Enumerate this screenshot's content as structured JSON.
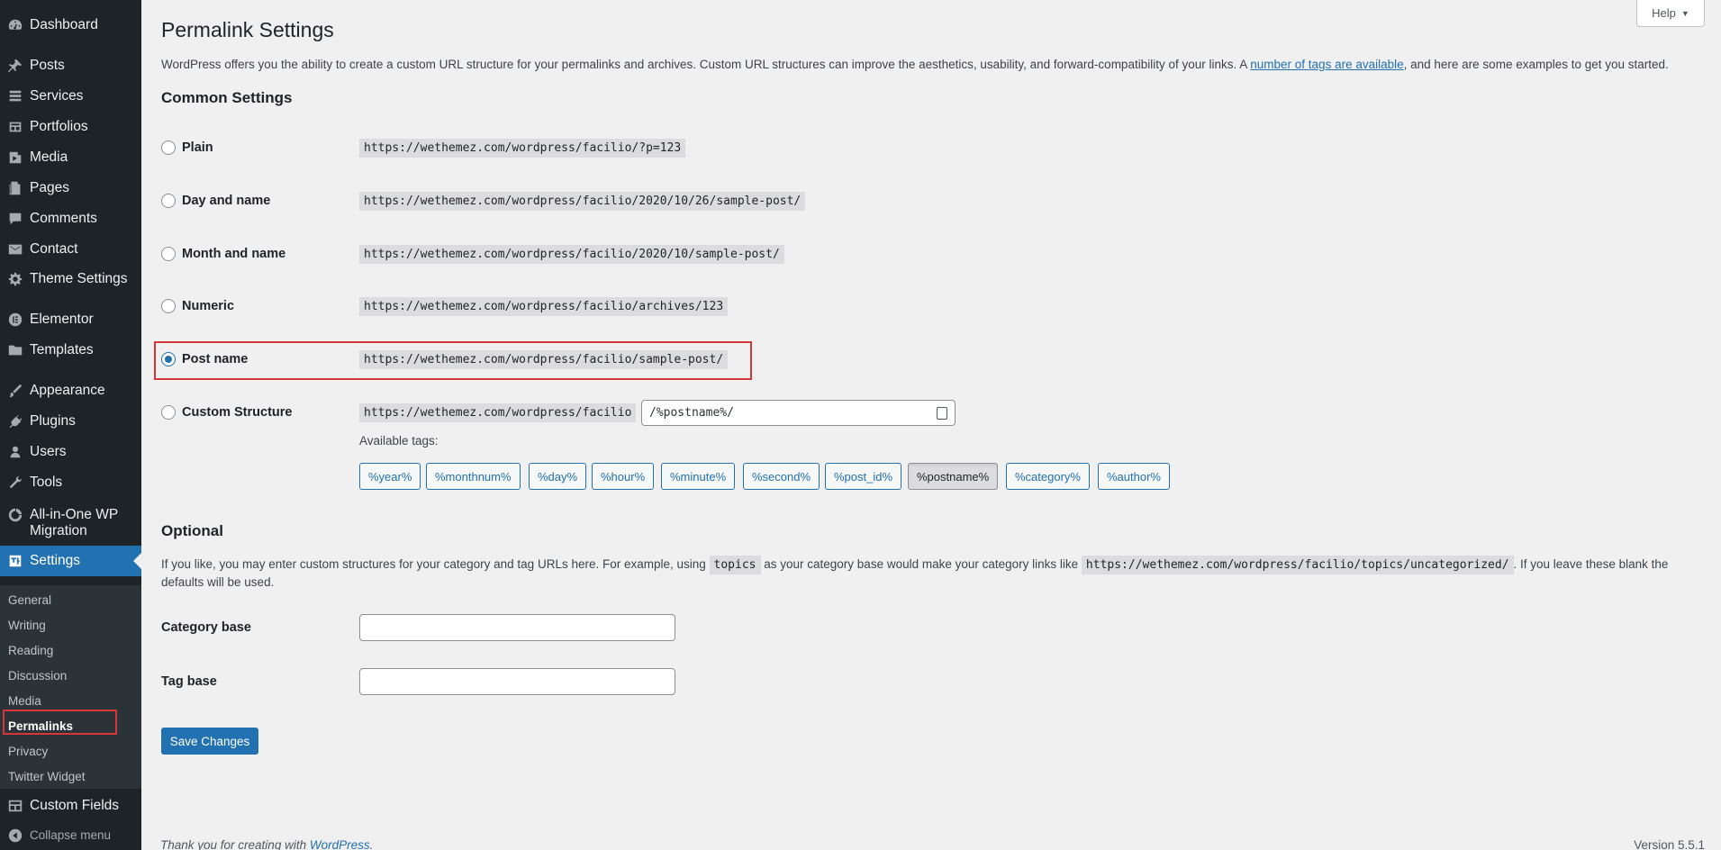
{
  "sidebar": {
    "items": [
      {
        "label": "Dashboard",
        "icon": "dashboard-icon"
      },
      {
        "label": "Posts",
        "icon": "pin-icon"
      },
      {
        "label": "Services",
        "icon": "list-icon"
      },
      {
        "label": "Portfolios",
        "icon": "portfolio-icon"
      },
      {
        "label": "Media",
        "icon": "media-icon"
      },
      {
        "label": "Pages",
        "icon": "pages-icon"
      },
      {
        "label": "Comments",
        "icon": "comment-icon"
      },
      {
        "label": "Contact",
        "icon": "mail-icon"
      },
      {
        "label": "Theme Settings",
        "icon": "gear-icon"
      },
      {
        "label": "Elementor",
        "icon": "elementor-icon"
      },
      {
        "label": "Templates",
        "icon": "folder-icon"
      },
      {
        "label": "Appearance",
        "icon": "brush-icon"
      },
      {
        "label": "Plugins",
        "icon": "plugin-icon"
      },
      {
        "label": "Users",
        "icon": "user-icon"
      },
      {
        "label": "Tools",
        "icon": "wrench-icon"
      },
      {
        "label": "All-in-One WP",
        "label2": "Migration",
        "icon": "migration-icon"
      },
      {
        "label": "Settings",
        "icon": "settings-icon"
      },
      {
        "label": "Custom Fields",
        "icon": "table-icon"
      },
      {
        "label": "Collapse menu",
        "icon": "collapse-icon"
      }
    ],
    "submenu": [
      "General",
      "Writing",
      "Reading",
      "Discussion",
      "Media",
      "Permalinks",
      "Privacy",
      "Twitter Widget"
    ]
  },
  "header": {
    "title": "Permalink Settings",
    "help": "Help",
    "intro_before": "WordPress offers you the ability to create a custom URL structure for your permalinks and archives. Custom URL structures can improve the aesthetics, usability, and forward-compatibility of your links. A ",
    "intro_link": "number of tags are available",
    "intro_after": ", and here are some examples to get you started."
  },
  "common": {
    "heading": "Common Settings",
    "options": [
      {
        "label": "Plain",
        "example": "https://wethemez.com/wordpress/facilio/?p=123"
      },
      {
        "label": "Day and name",
        "example": "https://wethemez.com/wordpress/facilio/2020/10/26/sample-post/"
      },
      {
        "label": "Month and name",
        "example": "https://wethemez.com/wordpress/facilio/2020/10/sample-post/"
      },
      {
        "label": "Numeric",
        "example": "https://wethemez.com/wordpress/facilio/archives/123"
      },
      {
        "label": "Post name",
        "example": "https://wethemez.com/wordpress/facilio/sample-post/"
      },
      {
        "label": "Custom Structure",
        "example": "https://wethemez.com/wordpress/facilio"
      }
    ],
    "selected": "Post name",
    "custom_value": "/%postname%/",
    "available_tags_label": "Available tags:",
    "tags": [
      "%year%",
      "%monthnum%",
      "%day%",
      "%hour%",
      "%minute%",
      "%second%",
      "%post_id%",
      "%postname%",
      "%category%",
      "%author%"
    ],
    "active_tag": "%postname%"
  },
  "optional": {
    "heading": "Optional",
    "text_1": "If you like, you may enter custom structures for your category and tag URLs here. For example, using ",
    "code_1": "topics",
    "text_2": " as your category base would make your category links like ",
    "code_2": "https://wethemez.com/wordpress/facilio/topics/uncategorized/",
    "text_3": ". If you leave these blank the defaults will be used.",
    "category_label": "Category base",
    "category_value": "",
    "tag_label": "Tag base",
    "tag_value": ""
  },
  "save_label": "Save Changes",
  "footer": {
    "thanks_before": "Thank you for creating with ",
    "thanks_link": "WordPress",
    "thanks_after": ".",
    "version": "Version 5.5.1"
  },
  "colors": {
    "accent": "#2271b1",
    "highlight": "#d63638",
    "sidebar": "#1d2327"
  }
}
